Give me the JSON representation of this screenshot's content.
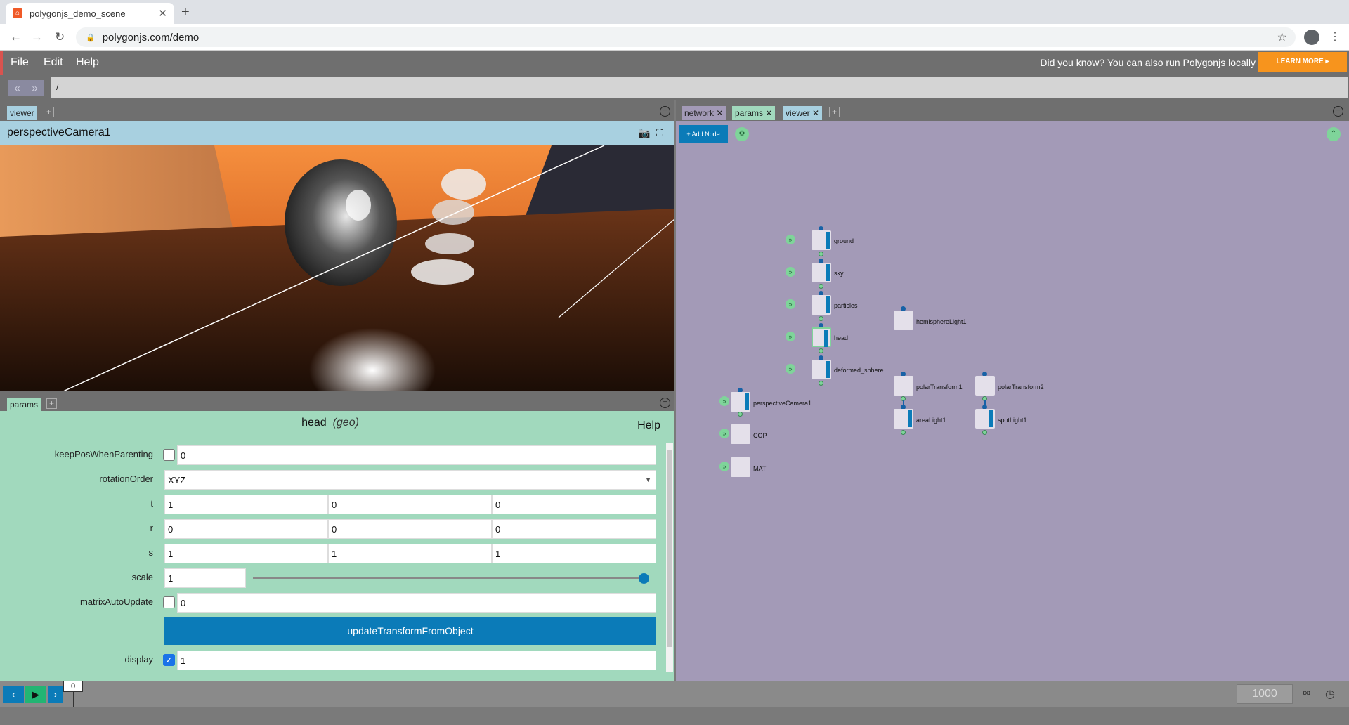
{
  "browser": {
    "tab_title": "polygonjs_demo_scene",
    "new_tab": "+",
    "url": "polygonjs.com/demo"
  },
  "menu": {
    "file": "File",
    "edit": "Edit",
    "help": "Help",
    "notice": "Did you know? You can also run Polygonjs locally",
    "learn_more": "LEARN MORE ▸"
  },
  "path": {
    "value": "/"
  },
  "left_top": {
    "tab": "viewer",
    "camera": "perspectiveCamera1"
  },
  "left_bottom": {
    "tab": "params",
    "node_name": "head",
    "node_type": "(geo)",
    "help": "Help",
    "params": {
      "keepPosWhenParenting": {
        "label": "keepPosWhenParenting",
        "value": "0"
      },
      "rotationOrder": {
        "label": "rotationOrder",
        "value": "XYZ"
      },
      "t": {
        "label": "t",
        "x": "1",
        "y": "0",
        "z": "0"
      },
      "r": {
        "label": "r",
        "x": "0",
        "y": "0",
        "z": "0"
      },
      "s": {
        "label": "s",
        "x": "1",
        "y": "1",
        "z": "1"
      },
      "scale": {
        "label": "scale",
        "value": "1"
      },
      "matrixAutoUpdate": {
        "label": "matrixAutoUpdate",
        "value": "0"
      },
      "update_button": "updateTransformFromObject",
      "display": {
        "label": "display",
        "value": "1"
      }
    }
  },
  "right": {
    "tabs": [
      "network",
      "params",
      "viewer"
    ],
    "add_node": "+ Add Node",
    "nodes": {
      "ground": "ground",
      "sky": "sky",
      "particles": "particles",
      "head": "head",
      "deformed_sphere": "deformed_sphere",
      "hemisphereLight1": "hemisphereLight1",
      "polarTransform1": "polarTransform1",
      "polarTransform2": "polarTransform2",
      "areaLight1": "areaLight1",
      "spotLight1": "spotLight1",
      "perspectiveCamera1": "perspectiveCamera1",
      "COP": "COP",
      "MAT": "MAT"
    }
  },
  "timeline": {
    "current_frame": "0",
    "end_frame": "1000"
  },
  "colors": {
    "accent": "#0b7bb8",
    "params_bg": "#a1d9bd",
    "network_bg": "#a39ab7",
    "viewer_header": "#a8d0e0",
    "learn_more": "#f7941d"
  }
}
